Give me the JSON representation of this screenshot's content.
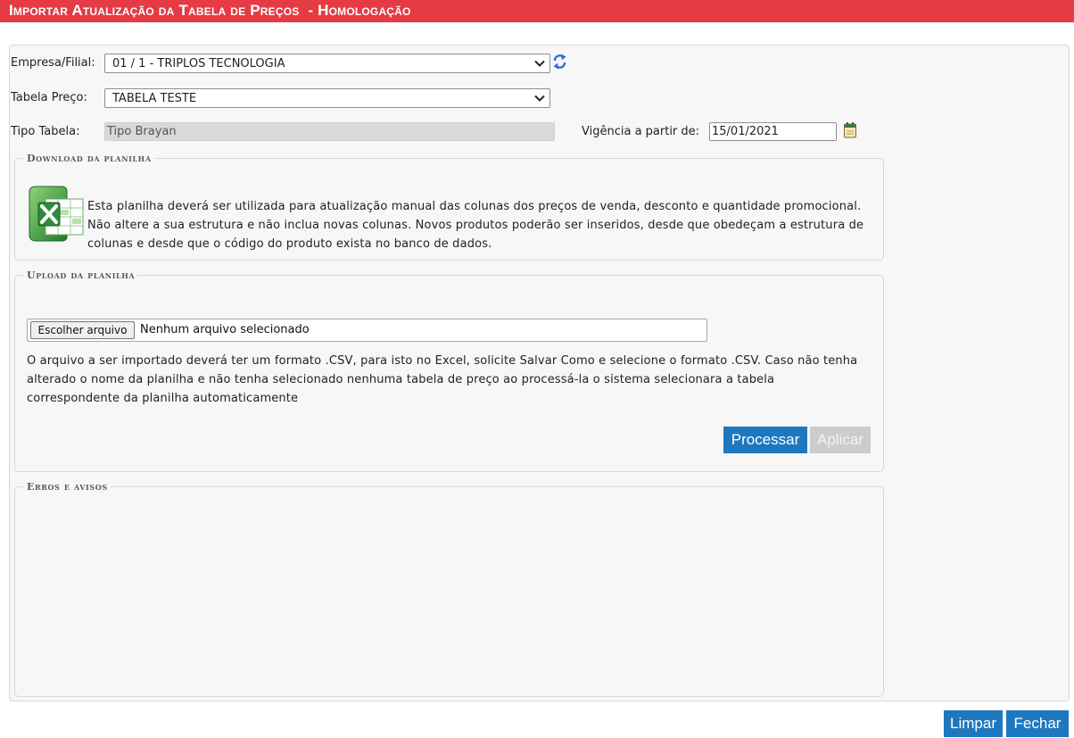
{
  "header": {
    "title": "Importar Atualização da Tabela de Preços  - Homologação",
    "color": "#e63a44"
  },
  "form": {
    "empresa_label": "Empresa/Filial:",
    "empresa_value": "01 / 1 - TRIPLOS TECNOLOGIA",
    "tabela_label": "Tabela Preço:",
    "tabela_value": "TABELA TESTE",
    "tipo_label": "Tipo Tabela:",
    "tipo_value": "Tipo Brayan",
    "vigencia_label": "Vigência a partir de:",
    "vigencia_value": "15/01/2021"
  },
  "download": {
    "legend": "Download da planilha",
    "text_lines": [
      "Esta planilha deverá ser utilizada para atualização manual das colunas dos preços de venda, desconto e quantidade promocional.",
      "Não altere a sua estrutura e não inclua novas colunas. Novos produtos poderão ser inseridos, desde que obedeçam a estrutura de",
      "colunas e desde que o código do produto exista no banco de dados."
    ],
    "icon": "excel-icon"
  },
  "upload": {
    "legend": "Upload da planilha",
    "choose_label": "Escolher arquivo",
    "file_status": "Nenhum arquivo selecionado",
    "text_lines": [
      "O arquivo a ser importado deverá ter um formato .CSV, para isto no Excel, solicite Salvar Como e selecione o formato .CSV. Caso não tenha",
      "alterado o nome da planilha e não tenha selecionado nenhuma tabela de preço ao processá-la o sistema selecionara a tabela",
      "correspondente da planilha automaticamente"
    ],
    "process_label": "Processar",
    "apply_label": "Aplicar"
  },
  "errors": {
    "legend": "Erros e avisos"
  },
  "footer": {
    "clear_label": "Limpar",
    "close_label": "Fechar"
  },
  "colors": {
    "primary_button": "#1d78c0",
    "disabled_button": "#cccccc"
  }
}
